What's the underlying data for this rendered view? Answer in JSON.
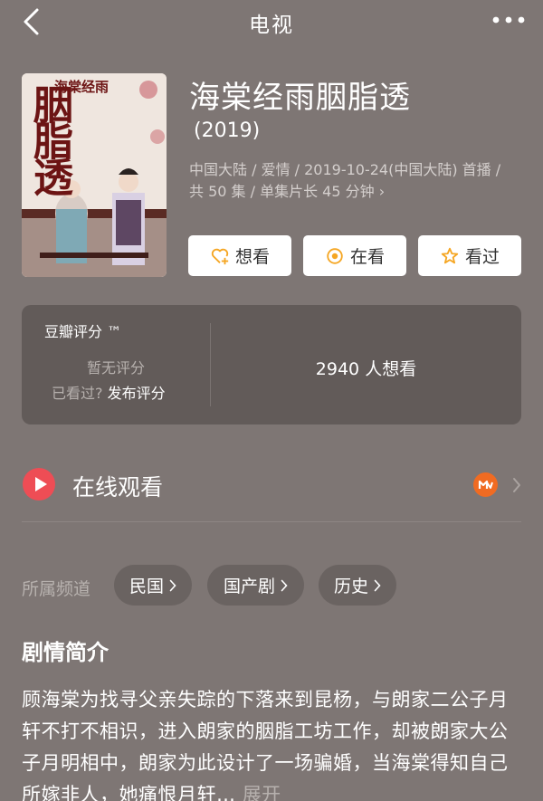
{
  "nav": {
    "title": "电视",
    "back_icon": "chevron-left-icon",
    "more_icon": "more-dots-icon"
  },
  "poster": {
    "title_text": "胭脂透",
    "subtitle_text": "海棠经雨"
  },
  "info": {
    "title": "海棠经雨胭脂透",
    "year": "(2019)",
    "meta": "中国大陆 / 爱情 / 2019-10-24(中国大陆) 首播 / 共 50 集 / 单集片长 45 分钟",
    "meta_chevron": "›"
  },
  "actions": [
    {
      "label": "想看",
      "icon": "heart-plus-icon",
      "color": "#f5a623"
    },
    {
      "label": "在看",
      "icon": "target-icon",
      "color": "#f5a623"
    },
    {
      "label": "看过",
      "icon": "star-icon",
      "color": "#f5a623"
    }
  ],
  "rating": {
    "label": "豆瓣评分 ™",
    "no_rating": "暂无评分",
    "seen_prompt": "已看过?",
    "publish_link": "发布评分",
    "want_count": "2940 人想看"
  },
  "watch": {
    "label": "在线观看",
    "play_icon_color": "#ee4d55",
    "provider_icon": "mango-tv-icon",
    "provider_color": "#f06b22"
  },
  "channels": {
    "label": "所属频道",
    "items": [
      "民国",
      "国产剧",
      "历史"
    ]
  },
  "synopsis": {
    "title": "剧情简介",
    "text": "顾海棠为找寻父亲失踪的下落来到昆杨，与朗家二公子月轩不打不相识，进入朗家的胭脂工坊工作，却被朗家大公子月明相中，朗家为此设计了一场骗婚，当海棠得知自己所嫁非人，她痛恨月轩…",
    "expand": "展开"
  }
}
